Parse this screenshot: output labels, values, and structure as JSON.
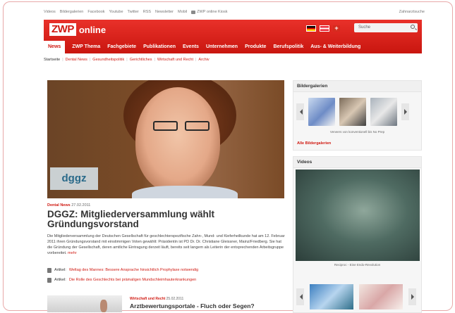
{
  "utility_nav": [
    "Videos",
    "Bildergalerien",
    "Facebook",
    "Youtube",
    "Twitter",
    "RSS",
    "Newsletter",
    "Mobil"
  ],
  "zwp_kiosk": "ZWP online Kiosk",
  "zahnarztsuche": "Zahnarztsuche",
  "logo": {
    "brand": "ZWP",
    "suffix": "online"
  },
  "search_placeholder": "Suche",
  "main_nav": [
    "News",
    "ZWP Thema",
    "Fachgebiete",
    "Publikationen",
    "Events",
    "Unternehmen",
    "Produkte",
    "Berufspolitik",
    "Aus- & Weiterbildung"
  ],
  "breadcrumb": [
    "Startseite",
    "Dental News",
    "Gesundheitspolitik",
    "Gerichtliches",
    "Wirtschaft und Recht",
    "Archiv"
  ],
  "hero": {
    "badge": "dggz"
  },
  "article": {
    "category": "Dental News",
    "date": "27.02.2011",
    "title": "DGGZ: Mitgliederversammlung wählt Gründungsvorstand",
    "body": "Die Mitgliederversammlung der Deutschen Gesellschaft für geschlechterspezifische Zahn-, Mund- und Kieferheilkunde hat am 12. Februar 2011 ihren Gründungsvorstand mit einstimmigen Voten gewählt: Präsidentin ist PD Dr. Dr. Christiane Gleissner, Mainz/Friedberg. Sie hat die Gründung der Gesellschaft, deren amtliche Eintragung derzeit läuft, bereits seit langem als Leiterin der entsprechenden Arbeitsgruppe vorbereitet.",
    "more": "mehr",
    "related_prefix": "Artikel:",
    "related": [
      "Weltag des Mannes: Bessere Ansprache hinsichtlich Prophylaxe notwendig",
      "Die Rolle des Geschlechts bei prämaligen Mundschleimhauterkrankungen"
    ]
  },
  "teaser": {
    "category": "Wirtschaft und Recht",
    "date": "25.02.2011",
    "title": "Arztbewertungsportale - Fluch oder Segen?"
  },
  "gallery": {
    "title": "Bildergalerien",
    "caption": "Veneers von konventionell bis No Prep",
    "all_link": "Alle Bildergalerien"
  },
  "videos": {
    "title": "Videos",
    "caption": "Reciproc - Eine Endo-Revolution"
  }
}
